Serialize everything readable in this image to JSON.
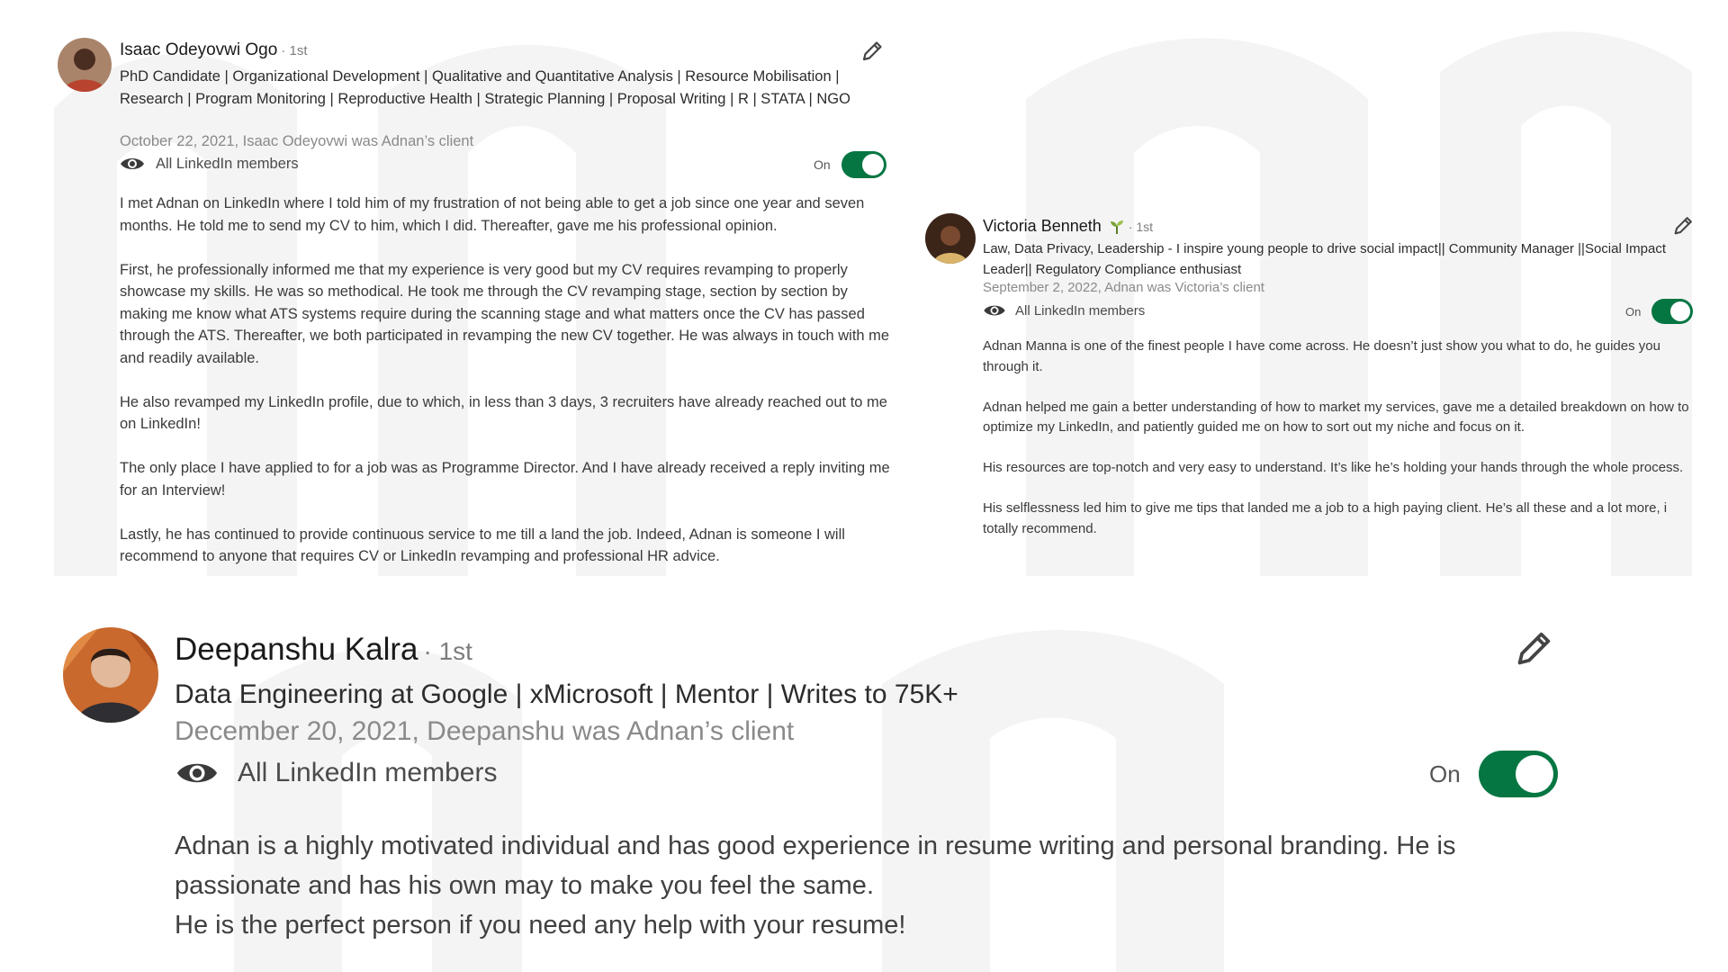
{
  "accent": {
    "toggle_on": "#057642",
    "text_muted": "#8a8a8a"
  },
  "recommendations": [
    {
      "name": "Isaac Odeyovwi Ogo",
      "degree": "· 1st",
      "headline": "PhD Candidate | Organizational Development | Qualitative and Quantitative Analysis | Resource Mobilisation | Research | Program Monitoring | Reproductive Health | Strategic Planning | Proposal Writing | R | STATA | NGO",
      "date": "October 22, 2021, Isaac Odeyovwi was Adnan’s client",
      "visibility": "All LinkedIn members",
      "toggle_label": "On",
      "toggle_on": true,
      "edit_icon": "pencil-icon",
      "paragraphs": [
        "I met Adnan on LinkedIn where I told him of my frustration of not being able to get a job since one year and seven months. He told me to send my CV to him, which I did. Thereafter, gave me his professional opinion.",
        "First, he professionally informed me that my experience is very good but my CV requires revamping to properly showcase my skills. He was so methodical. He took me through the CV revamping stage, section by section by making me know what ATS systems require during the scanning stage and what matters once the CV has passed through the ATS. Thereafter, we both participated in revamping the new CV together. He was always in touch with me and readily available.",
        "He also revamped my LinkedIn profile, due to which, in less than 3 days, 3 recruiters have already reached out to me on LinkedIn!",
        "The only place I have applied to for a job was as Programme Director. And I have already received a reply inviting me for an Interview!",
        "Lastly, he has continued to provide continuous service to me till a land the job. Indeed, Adnan is someone I will recommend to anyone that requires CV or LinkedIn revamping and professional HR advice."
      ]
    },
    {
      "name": "Victoria Benneth",
      "badge_icon": "sprout-icon",
      "degree": "· 1st",
      "headline": "Law, Data Privacy, Leadership - I inspire young people to drive social impact|| Community Manager ||Social Impact Leader|| Regulatory Compliance enthusiast",
      "date": "September 2, 2022, Adnan was Victoria’s client",
      "visibility": "All LinkedIn members",
      "toggle_label": "On",
      "toggle_on": true,
      "edit_icon": "pencil-icon",
      "paragraphs": [
        "Adnan Manna is one of the finest people I have come across. He doesn’t just show you what to do, he guides you through it.",
        "Adnan helped me gain a better understanding of how to market my services, gave me a detailed breakdown on how to optimize my LinkedIn, and patiently guided me on how to sort out my niche and focus on it.",
        " His resources are top-notch and very easy to understand. It’s like he’s holding your hands through the whole process.",
        "His selflessness led him to give me tips that landed me a job to a high paying client. He’s all these and a lot more, i totally recommend."
      ]
    },
    {
      "name": "Deepanshu Kalra",
      "degree": "· 1st",
      "headline": "Data Engineering at Google | xMicrosoft | Mentor | Writes to 75K+",
      "date": "December 20, 2021, Deepanshu was Adnan’s client",
      "visibility": "All LinkedIn members",
      "toggle_label": "On",
      "toggle_on": true,
      "edit_icon": "pencil-icon",
      "paragraphs": [
        "Adnan is a highly motivated individual and has good experience in resume writing and personal branding. He is passionate and has his own may to make you feel the same.",
        "He is the perfect person if you need any help with your resume!"
      ]
    }
  ]
}
